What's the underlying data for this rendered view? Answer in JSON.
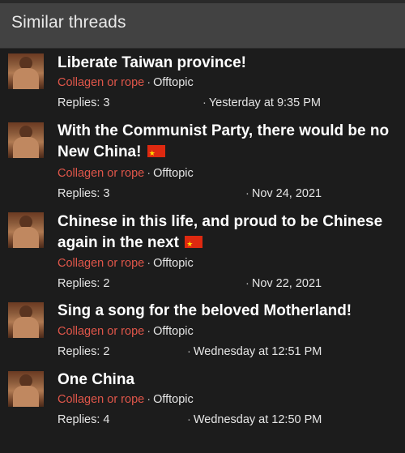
{
  "section": {
    "title": "Similar threads"
  },
  "threads": [
    {
      "title": "Liberate Taiwan province!",
      "title_line2": "",
      "has_flag": false,
      "author": "Collagen or rope",
      "forum": "Offtopic",
      "replies": "Replies: 3",
      "date": "Yesterday at 9:35 PM"
    },
    {
      "title": "With the Communist Party, there would be no",
      "title_line2": "New China!",
      "has_flag": true,
      "author": "Collagen or rope",
      "forum": "Offtopic",
      "replies": "Replies: 3",
      "date": "Nov 24, 2021"
    },
    {
      "title": "Chinese in this life, and proud to be Chinese",
      "title_line2": "again in the next",
      "has_flag": true,
      "author": "Collagen or rope",
      "forum": "Offtopic",
      "replies": "Replies: 2",
      "date": "Nov 22, 2021"
    },
    {
      "title": "Sing a song for the beloved Motherland!",
      "title_line2": "",
      "has_flag": false,
      "author": "Collagen or rope",
      "forum": "Offtopic",
      "replies": "Replies: 2",
      "date": "Wednesday at 12:51 PM"
    },
    {
      "title": "One China",
      "title_line2": "",
      "has_flag": false,
      "author": "Collagen or rope",
      "forum": "Offtopic",
      "replies": "Replies: 4",
      "date": "Wednesday at 12:50 PM"
    }
  ],
  "colors": {
    "header_bg": "#424242",
    "body_bg": "#1c1c1c",
    "author_link": "#e0564a",
    "title_text": "#ffffff"
  },
  "icons": {
    "flag": "china-flag-icon",
    "avatar": "user-avatar"
  }
}
